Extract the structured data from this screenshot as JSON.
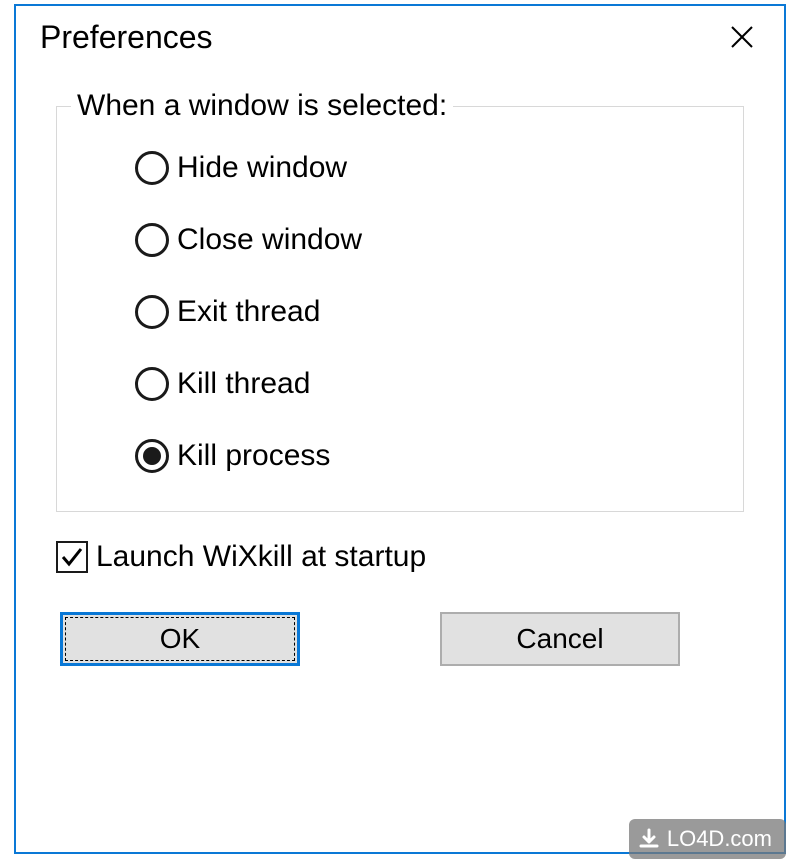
{
  "dialog": {
    "title": "Preferences",
    "fieldset_legend": "When a window is selected:",
    "radio_options": [
      {
        "id": "hide-window",
        "label": "Hide window",
        "selected": false
      },
      {
        "id": "close-window",
        "label": "Close window",
        "selected": false
      },
      {
        "id": "exit-thread",
        "label": "Exit thread",
        "selected": false
      },
      {
        "id": "kill-thread",
        "label": "Kill thread",
        "selected": false
      },
      {
        "id": "kill-process",
        "label": "Kill process",
        "selected": true
      }
    ],
    "checkbox": {
      "label": "Launch WiXkill at startup",
      "checked": true
    },
    "buttons": {
      "ok": "OK",
      "cancel": "Cancel"
    }
  },
  "watermark": {
    "text": "LO4D.com"
  }
}
